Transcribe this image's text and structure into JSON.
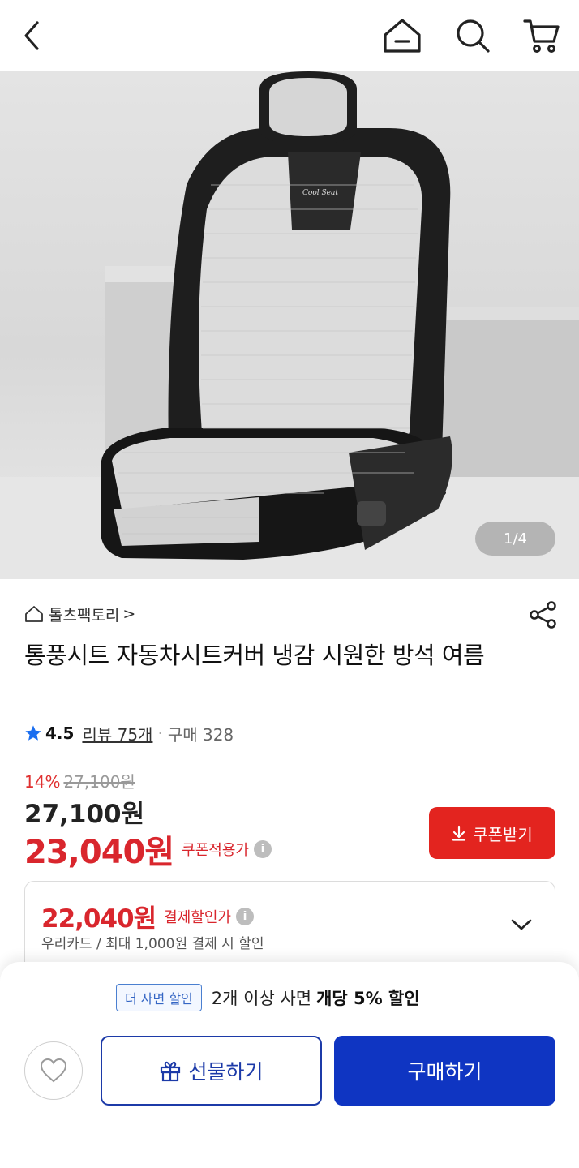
{
  "icons": {
    "back": "chevron-left-icon",
    "home": "home-icon",
    "search": "search-icon",
    "cart": "cart-icon",
    "share": "share-icon",
    "star": "star-icon",
    "info": "info-icon",
    "download": "download-icon",
    "chevron_down": "chevron-down-icon",
    "heart": "heart-icon",
    "gift": "gift-icon"
  },
  "hero": {
    "image_counter": "1/4",
    "seat_logo_text": "Cool Seat"
  },
  "seller": {
    "name": "톨츠팩토리",
    "chevron": ">"
  },
  "product": {
    "title": "통풍시트 자동차시트커버 냉감 시원한 방석 여름",
    "rating": "4.5",
    "review_link": "리뷰 75개",
    "separator": "·",
    "purchase_count": "구매 328"
  },
  "pricing": {
    "discount_percent": "14%",
    "original_price": "27,100원",
    "current_price": "27,100원",
    "coupon_price": "23,040원",
    "coupon_price_label": "쿠폰적용가",
    "info_glyph": "i",
    "coupon_button_label": "쿠폰받기"
  },
  "payment_discount": {
    "price": "22,040원",
    "label": "결제할인가",
    "info_glyph": "i",
    "description": "우리카드 / 최대 1,000원 결제 시 할인"
  },
  "bottom_sheet": {
    "promo_badge": "더 사면 할인",
    "promo_text": "2개 이상 사면",
    "promo_strong": "개당 5% 할인",
    "gift_button": "선물하기",
    "buy_button": "구매하기"
  },
  "colors": {
    "accent_red": "#e3241f",
    "price_red": "#d9262d",
    "primary_blue": "#0f35c2",
    "outline_blue": "#1c3aa8",
    "star_blue": "#1a6ef0"
  }
}
